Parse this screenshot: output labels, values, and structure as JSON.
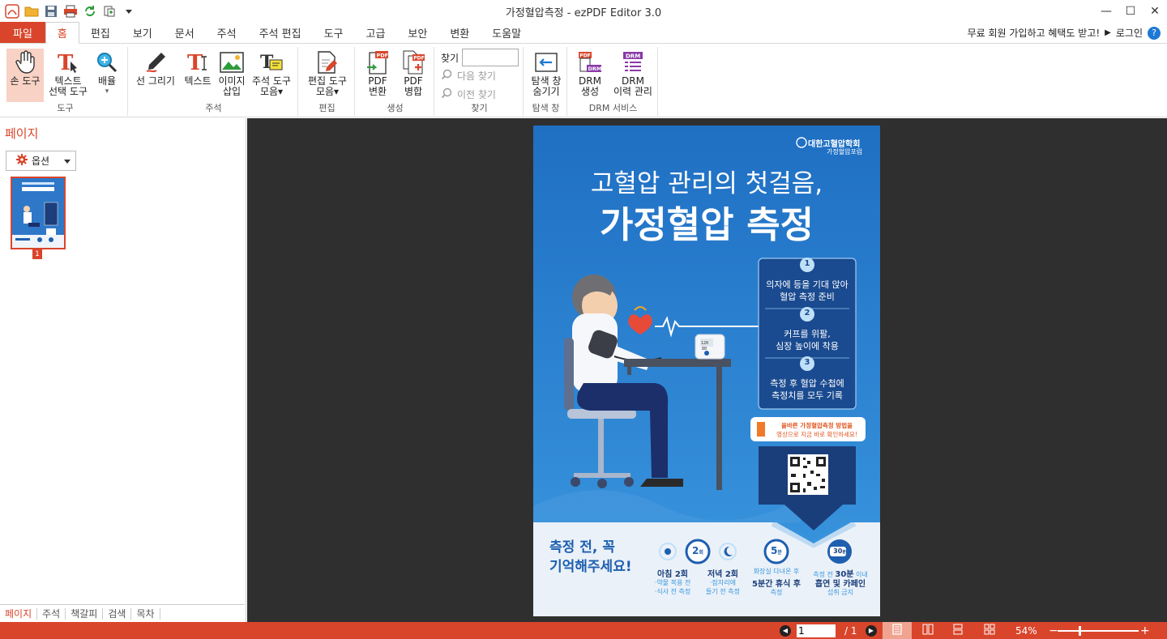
{
  "window": {
    "title": "가정혈압측정 - ezPDF Editor 3.0",
    "minimize": "—",
    "maximize": "☐",
    "close": "✕"
  },
  "menu": {
    "file": "파일",
    "tabs": [
      "홈",
      "편집",
      "보기",
      "문서",
      "주석",
      "주석 편집",
      "도구",
      "고급",
      "보안",
      "변환",
      "도움말"
    ],
    "promo": "무료 회원 가입하고 혜택도 받고!",
    "login": "로그인",
    "play_glyph": "▶",
    "help_glyph": "?"
  },
  "ribbon": {
    "tools_group": {
      "label": "도구",
      "hand": "손 도구",
      "text_select_1": "텍스트",
      "text_select_2": "선택 도구",
      "zoom": "배율",
      "zoom_arrow": "▾"
    },
    "annot_group": {
      "label": "주석",
      "line": "선 그리기",
      "text": "텍스트",
      "image_1": "이미지",
      "image_2": "삽입",
      "annot_tools_1": "주석 도구",
      "annot_tools_2": "모음▾"
    },
    "edit_group": {
      "label": "편집",
      "edit_tools_1": "편집 도구",
      "edit_tools_2": "모음▾"
    },
    "create_group": {
      "label": "생성",
      "pdf_convert_1": "PDF",
      "pdf_convert_2": "변환",
      "pdf_merge_1": "PDF",
      "pdf_merge_2": "병합"
    },
    "find_group": {
      "label": "찾기",
      "find": "찾기",
      "next": "다음 찾기",
      "prev": "이전 찾기"
    },
    "nav_group": {
      "label": "탐색 창",
      "hide_1": "탐색 창",
      "hide_2": "숨기기"
    },
    "drm_group": {
      "label": "DRM 서비스",
      "create_1": "DRM",
      "create_2": "생성",
      "history_1": "DRM",
      "history_2": "이력 관리"
    }
  },
  "left_panel": {
    "title": "페이지",
    "options": "옵션",
    "thumb_page": "1",
    "tabs": [
      "페이지",
      "주석",
      "책갈피",
      "검색",
      "목차"
    ]
  },
  "poster": {
    "org_1": "대한고혈압학회",
    "org_2": "가정혈압포럼",
    "headline_1": "고혈압 관리의 첫걸음,",
    "headline_2": "가정혈압 측정",
    "step1_num": "1",
    "step1_a": "의자에 등을 기대 앉아",
    "step1_b": "혈압 측정 준비",
    "step2_num": "2",
    "step2_a": "커프를 위팔,",
    "step2_b": "심장 높이에 착용",
    "step3_num": "3",
    "step3_a": "측정 후 혈압 수첩에",
    "step3_b": "측정치를 모두 기록",
    "monitor_a": "120",
    "monitor_b": "80",
    "video_a": "올바른 가정혈압측정 방법을",
    "video_b": "영상으로 지금 바로 확인하세요!",
    "remember_1": "측정 전, 꼭",
    "remember_2": "기억해주세요!",
    "b1_badge": "2",
    "b1_unit": "회",
    "b1_title": "아침 2회",
    "b1_l1": "·약물 복용 전",
    "b1_l2": "·식사 전 측정",
    "b2_title": "저녁 2회",
    "b2_l1": "·잠자리에",
    "b2_l2": "들기 전 측정",
    "b3_badge": "5",
    "b3_unit": "분",
    "b3_l1": "화장실 다녀온 후",
    "b3_title": "5분간 휴식 후",
    "b3_l2": "측정",
    "b4_badge": "30",
    "b4_unit": "분",
    "b4_l1a": "측정 전 ",
    "b4_l1b": "30분",
    "b4_l1c": " 이내",
    "b4_title": "흡연 및 카페인",
    "b4_l2": "섭취 금지"
  },
  "status": {
    "current_page": "1",
    "total_pages": "/ 1",
    "zoom": "54%",
    "minus": "−",
    "plus": "+",
    "prev_glyph": "◀",
    "next_glyph": "▶"
  },
  "colors": {
    "accent": "#d9452b",
    "poster_blue": "#2a7fd0",
    "poster_navy": "#1a3e7a",
    "dark_bg": "#2f2f2f"
  }
}
